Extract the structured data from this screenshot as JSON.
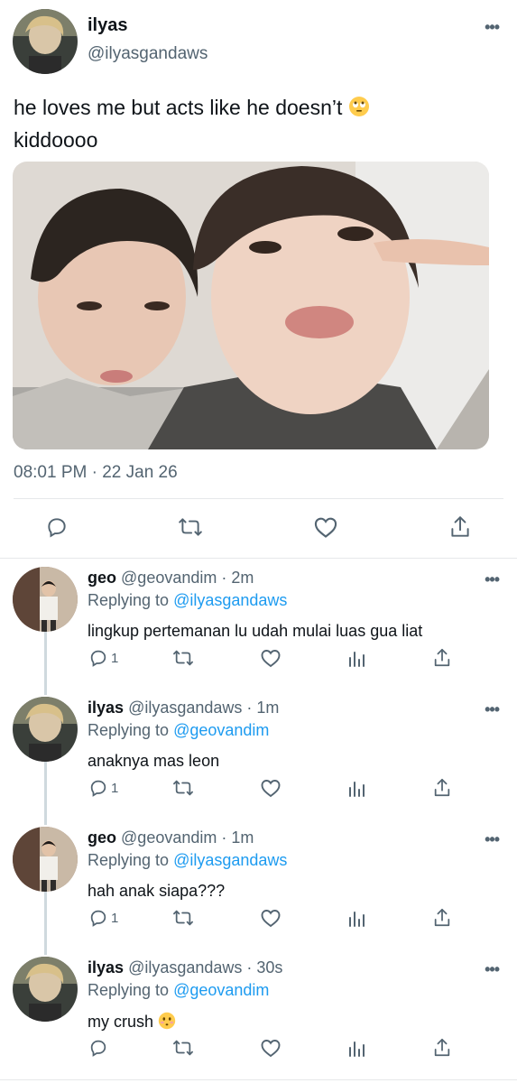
{
  "main_tweet": {
    "display_name": "ilyas",
    "handle": "@ilyasgandaws",
    "text": "he loves me but acts like he doesn’t",
    "text_line2": "kiddoooo",
    "emoji": "eye-roll-emoji",
    "timestamp": "08:01 PM · 22 Jan 26",
    "more_label": "•••",
    "actions": [
      "reply-icon",
      "retweet-icon",
      "like-icon",
      "share-icon"
    ]
  },
  "replies": [
    {
      "display_name": "geo",
      "handle": "@geovandim",
      "sep": " · ",
      "time": "2m",
      "replying_prefix": "Replying to ",
      "replying_to": "@ilyasgandaws",
      "text": "lingkup pertemanan lu udah mulai luas gua liat",
      "reply_count": "1"
    },
    {
      "display_name": "ilyas",
      "handle": "@ilyasgandaws",
      "sep": " · ",
      "time": "1m",
      "replying_prefix": "Replying to ",
      "replying_to": "@geovandim",
      "text": "anaknya mas leon",
      "reply_count": "1"
    },
    {
      "display_name": "geo",
      "handle": "@geovandim",
      "sep": " · ",
      "time": "1m",
      "replying_prefix": "Replying to ",
      "replying_to": "@ilyasgandaws",
      "text": "hah anak siapa???",
      "reply_count": "1"
    },
    {
      "display_name": "ilyas",
      "handle": "@ilyasgandaws",
      "sep": " · ",
      "time": "30s",
      "replying_prefix": "Replying to ",
      "replying_to": "@geovandim",
      "text": "my crush",
      "emoji": "shy-face-emoji",
      "reply_count": ""
    }
  ],
  "colors": {
    "link": "#1d9bf0",
    "secondary": "#536471",
    "divider": "#e6e8ea",
    "thread_line": "#cfd9de"
  }
}
